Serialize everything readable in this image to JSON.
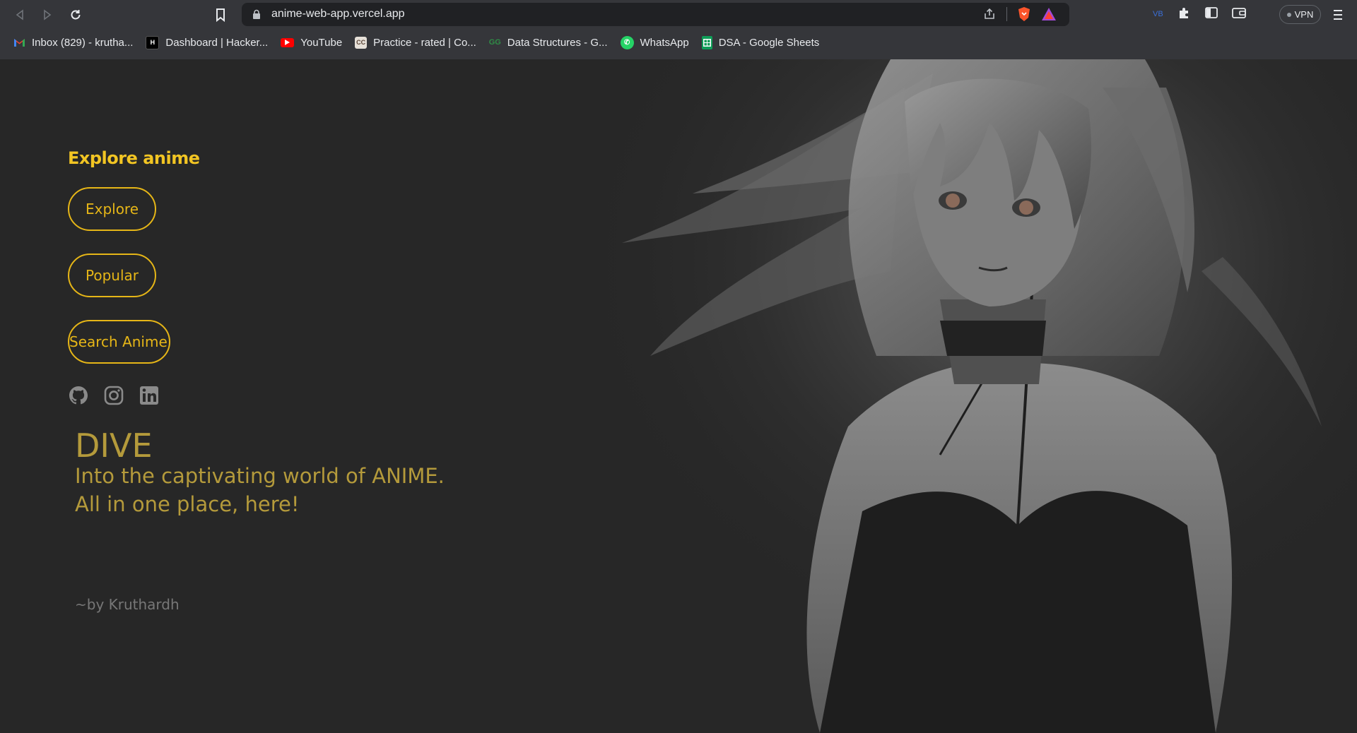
{
  "browser": {
    "url": "anime-web-app.vercel.app",
    "vpn_label": "VPN",
    "bookmarks": [
      {
        "label": "Inbox (829) - krutha...",
        "icon": "gmail-icon",
        "color": "#ea4335"
      },
      {
        "label": "Dashboard | Hacker...",
        "icon": "hackerrank-icon",
        "color": "#000000"
      },
      {
        "label": "YouTube",
        "icon": "youtube-icon",
        "color": "#ff0000"
      },
      {
        "label": "Practice - rated | Co...",
        "icon": "codechef-icon",
        "color": "#5b4638"
      },
      {
        "label": "Data Structures - G...",
        "icon": "geeksforgeeks-icon",
        "color": "#2f8d46"
      },
      {
        "label": "WhatsApp",
        "icon": "whatsapp-icon",
        "color": "#25d366"
      },
      {
        "label": "DSA - Google Sheets",
        "icon": "google-sheets-icon",
        "color": "#0f9d58"
      }
    ]
  },
  "page": {
    "brand": "Explore anime",
    "buttons": {
      "explore": "Explore",
      "popular": "Popular",
      "search": "Search Anime"
    },
    "socials": [
      "github-icon",
      "instagram-icon",
      "linkedin-icon"
    ],
    "headline": "DIVE",
    "tagline_line1": "Into the captivating world of ANIME.",
    "tagline_line2": "All in one place, here!",
    "byline": "~by Kruthardh"
  },
  "colors": {
    "accent": "#e6b617",
    "headline": "#b49a3b",
    "background": "#272727"
  }
}
